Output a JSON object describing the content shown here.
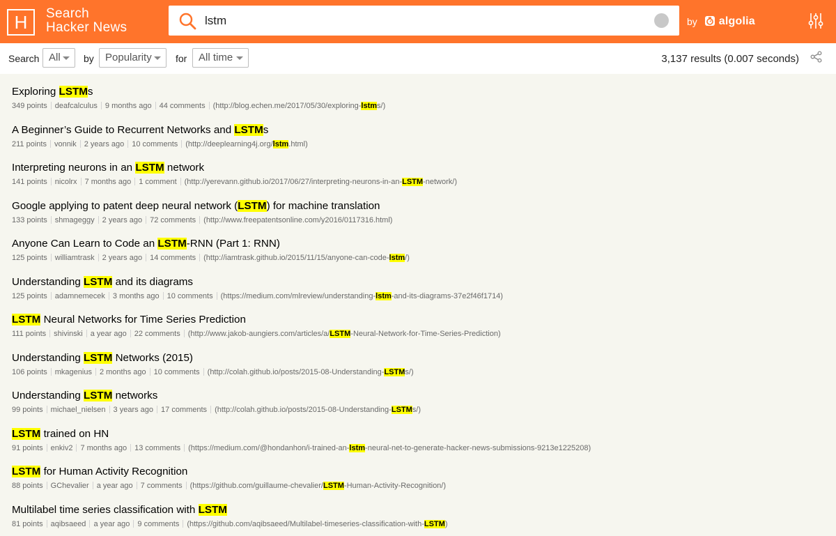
{
  "header": {
    "logo_letter": "H",
    "brand_line1": "Search",
    "brand_line2": "Hacker News",
    "search_value": "lstm",
    "by_label": "by",
    "algolia_label": "algolia"
  },
  "filters": {
    "search_label": "Search",
    "type_value": "All",
    "by_label": "by",
    "sort_value": "Popularity",
    "for_label": "for",
    "range_value": "All time",
    "results_summary": "3,137 results (0.007 seconds)"
  },
  "results": [
    {
      "title": [
        [
          "Exploring ",
          false
        ],
        [
          "LSTM",
          true
        ],
        [
          "s",
          false
        ]
      ],
      "points": "349 points",
      "author": "deafcalculus",
      "age": "9 months ago",
      "comments": "44 comments",
      "url": [
        [
          "(http://blog.echen.me/2017/05/30/exploring-",
          false
        ],
        [
          "lstm",
          true
        ],
        [
          "s/)",
          false
        ]
      ]
    },
    {
      "title": [
        [
          "A Beginner’s Guide to Recurrent Networks and ",
          false
        ],
        [
          "LSTM",
          true
        ],
        [
          "s",
          false
        ]
      ],
      "points": "211 points",
      "author": "vonnik",
      "age": "2 years ago",
      "comments": "10 comments",
      "url": [
        [
          "(http://deeplearning4j.org/",
          false
        ],
        [
          "lstm",
          true
        ],
        [
          ".html)",
          false
        ]
      ]
    },
    {
      "title": [
        [
          "Interpreting neurons in an ",
          false
        ],
        [
          "LSTM",
          true
        ],
        [
          " network",
          false
        ]
      ],
      "points": "141 points",
      "author": "nicolrx",
      "age": "7 months ago",
      "comments": "1 comment",
      "url": [
        [
          "(http://yerevann.github.io/2017/06/27/interpreting-neurons-in-an-",
          false
        ],
        [
          "LSTM",
          true
        ],
        [
          "-network/)",
          false
        ]
      ]
    },
    {
      "title": [
        [
          "Google applying to patent deep neural network (",
          false
        ],
        [
          "LSTM",
          true
        ],
        [
          ") for machine translation",
          false
        ]
      ],
      "points": "133 points",
      "author": "shmageggy",
      "age": "2 years ago",
      "comments": "72 comments",
      "url": [
        [
          "(http://www.freepatentsonline.com/y2016/0117316.html)",
          false
        ]
      ]
    },
    {
      "title": [
        [
          "Anyone Can Learn to Code an ",
          false
        ],
        [
          "LSTM",
          true
        ],
        [
          "-RNN (Part 1: RNN)",
          false
        ]
      ],
      "points": "125 points",
      "author": "williamtrask",
      "age": "2 years ago",
      "comments": "14 comments",
      "url": [
        [
          "(http://iamtrask.github.io/2015/11/15/anyone-can-code-",
          false
        ],
        [
          "lstm",
          true
        ],
        [
          "/)",
          false
        ]
      ]
    },
    {
      "title": [
        [
          "Understanding ",
          false
        ],
        [
          "LSTM",
          true
        ],
        [
          " and its diagrams",
          false
        ]
      ],
      "points": "125 points",
      "author": "adamnemecek",
      "age": "3 months ago",
      "comments": "10 comments",
      "url": [
        [
          "(https://medium.com/mlreview/understanding-",
          false
        ],
        [
          "lstm",
          true
        ],
        [
          "-and-its-diagrams-37e2f46f1714)",
          false
        ]
      ]
    },
    {
      "title": [
        [
          "LSTM",
          true
        ],
        [
          " Neural Networks for Time Series Prediction",
          false
        ]
      ],
      "points": "111 points",
      "author": "shivinski",
      "age": "a year ago",
      "comments": "22 comments",
      "url": [
        [
          "(http://www.jakob-aungiers.com/articles/a/",
          false
        ],
        [
          "LSTM",
          true
        ],
        [
          "-Neural-Network-for-Time-Series-Prediction)",
          false
        ]
      ]
    },
    {
      "title": [
        [
          "Understanding ",
          false
        ],
        [
          "LSTM",
          true
        ],
        [
          " Networks (2015)",
          false
        ]
      ],
      "points": "106 points",
      "author": "mkagenius",
      "age": "2 months ago",
      "comments": "10 comments",
      "url": [
        [
          "(http://colah.github.io/posts/2015-08-Understanding-",
          false
        ],
        [
          "LSTM",
          true
        ],
        [
          "s/)",
          false
        ]
      ]
    },
    {
      "title": [
        [
          "Understanding ",
          false
        ],
        [
          "LSTM",
          true
        ],
        [
          " networks",
          false
        ]
      ],
      "points": "99 points",
      "author": "michael_nielsen",
      "age": "3 years ago",
      "comments": "17 comments",
      "url": [
        [
          "(http://colah.github.io/posts/2015-08-Understanding-",
          false
        ],
        [
          "LSTM",
          true
        ],
        [
          "s/)",
          false
        ]
      ]
    },
    {
      "title": [
        [
          "LSTM",
          true
        ],
        [
          " trained on HN",
          false
        ]
      ],
      "points": "91 points",
      "author": "enkiv2",
      "age": "7 months ago",
      "comments": "13 comments",
      "url": [
        [
          "(https://medium.com/@hondanhon/i-trained-an-",
          false
        ],
        [
          "lstm",
          true
        ],
        [
          "-neural-net-to-generate-hacker-news-submissions-9213e1225208)",
          false
        ]
      ]
    },
    {
      "title": [
        [
          "LSTM",
          true
        ],
        [
          " for Human Activity Recognition",
          false
        ]
      ],
      "points": "88 points",
      "author": "GChevalier",
      "age": "a year ago",
      "comments": "7 comments",
      "url": [
        [
          "(https://github.com/guillaume-chevalier/",
          false
        ],
        [
          "LSTM",
          true
        ],
        [
          "-Human-Activity-Recognition/)",
          false
        ]
      ]
    },
    {
      "title": [
        [
          "Multilabel time series classification with ",
          false
        ],
        [
          "LSTM",
          true
        ]
      ],
      "points": "81 points",
      "author": "aqibsaeed",
      "age": "a year ago",
      "comments": "9 comments",
      "url": [
        [
          "(https://github.com/aqibsaeed/Multilabel-timeseries-classification-with-",
          false
        ],
        [
          "LSTM",
          true
        ],
        [
          ")",
          false
        ]
      ]
    }
  ],
  "colors": {
    "header_bg": "#ff742b",
    "list_bg": "#f6f6ef",
    "highlight": "#ffff00"
  }
}
